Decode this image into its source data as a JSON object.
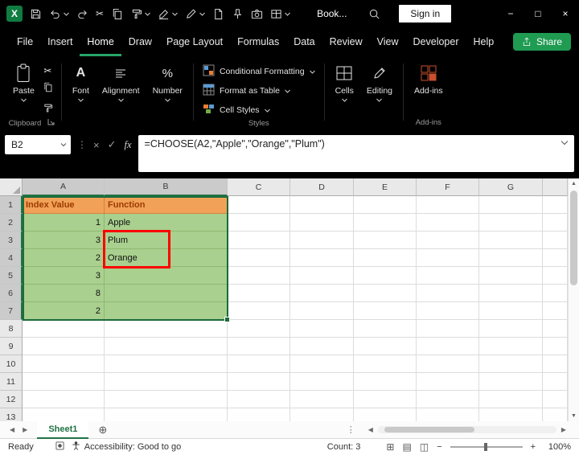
{
  "colors": {
    "excel_green": "#107C41",
    "accent_green": "#217346",
    "active_tab_underline": "#27A567",
    "share_green": "#1F9B52",
    "header_fill": "#F2A158",
    "header_text": "#9C3A00",
    "data_fill": "#A9D08E",
    "annotation_red": "#FE0000",
    "chrome_black": "#000000"
  },
  "titlebar": {
    "doc_title": "Book...",
    "sign_in_label": "Sign in",
    "window_controls": {
      "minimize": "−",
      "maximize": "□",
      "close": "×"
    }
  },
  "menubar": {
    "items": [
      "File",
      "Insert",
      "Home",
      "Draw",
      "Page Layout",
      "Formulas",
      "Data",
      "Review",
      "View",
      "Developer",
      "Help"
    ],
    "active": "Home",
    "share_label": "Share"
  },
  "ribbon": {
    "paste_label": "Paste",
    "font_label": "Font",
    "alignment_label": "Alignment",
    "number_label": "Number",
    "conditional_formatting_label": "Conditional Formatting",
    "format_as_table_label": "Format as Table",
    "cell_styles_label": "Cell Styles",
    "cells_label": "Cells",
    "editing_label": "Editing",
    "addins_label": "Add-ins",
    "group_clipboard": "Clipboard",
    "group_styles": "Styles",
    "group_addins": "Add-ins"
  },
  "formula_bar": {
    "name_box_value": "B2",
    "formula": "=CHOOSE(A2,\"Apple\",\"Orange\",\"Plum\")"
  },
  "grid": {
    "columns": [
      "A",
      "B",
      "C",
      "D",
      "E",
      "F",
      "G"
    ],
    "row_count": 13,
    "selected_range": "A1:B7",
    "active_cell": "B2",
    "cells": {
      "A1": "Index Value",
      "B1": "Function",
      "A2": "1",
      "B2": "Apple",
      "A3": "3",
      "B3": "Plum",
      "A4": "2",
      "B4": "Orange",
      "A5": "3",
      "A6": "8",
      "A7": "2"
    }
  },
  "sheetbar": {
    "tabs": [
      "Sheet1"
    ],
    "active_tab": "Sheet1"
  },
  "statusbar": {
    "mode": "Ready",
    "accessibility": "Accessibility: Good to go",
    "count": "Count: 3",
    "zoom": "100%"
  },
  "icons": {
    "cut": "✂",
    "check": "✓",
    "cancel": "×",
    "fx": "fx",
    "dots": "⋮",
    "add_sheet": "⊕",
    "left": "◀",
    "right": "▶",
    "up": "▲",
    "down": "▼",
    "normal_view": "⊞",
    "page_layout_view": "▤",
    "page_break_view": "◫",
    "zoom_out": "−",
    "zoom_in": "+",
    "percent": "%",
    "font_letter": "A"
  }
}
